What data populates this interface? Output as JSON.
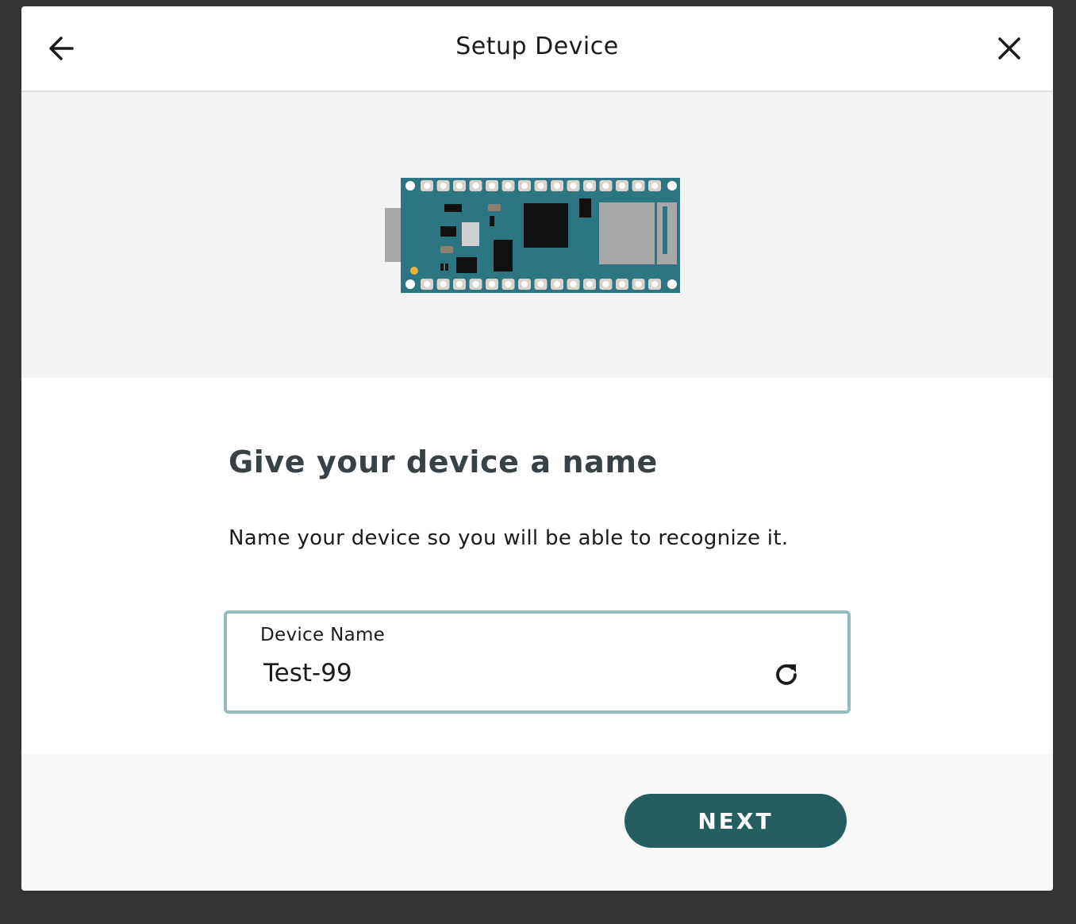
{
  "header": {
    "title": "Setup Device",
    "back_icon": "arrow-left-icon",
    "close_icon": "close-icon"
  },
  "hero": {
    "image": "arduino-board-illustration"
  },
  "main": {
    "heading": "Give your device a name",
    "description": "Name your device so you will be able to recognize it.",
    "field": {
      "label": "Device Name",
      "value": "Test-99",
      "refresh_icon": "refresh-icon"
    }
  },
  "footer": {
    "next_label": "NEXT"
  },
  "colors": {
    "backdrop": "#333333",
    "primary": "#245e5e",
    "field_border": "#95bbbd",
    "board": "#2e7583",
    "heading": "#374146"
  }
}
